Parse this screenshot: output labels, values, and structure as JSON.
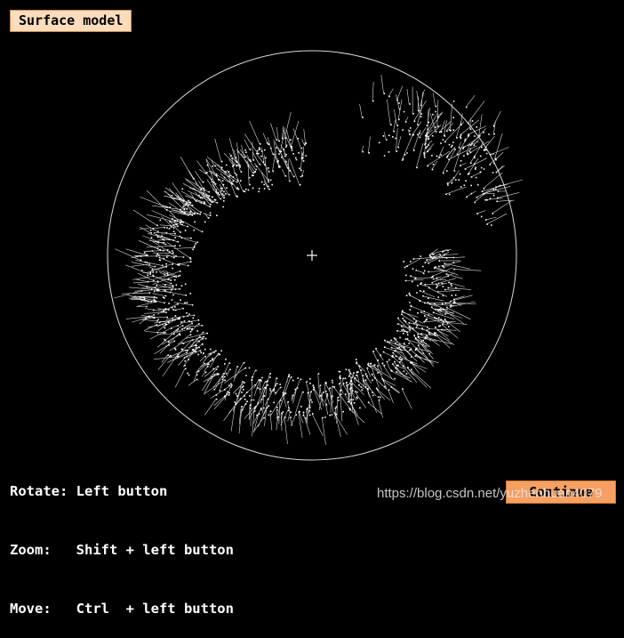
{
  "window": {
    "title_badge": "Surface model"
  },
  "viewport": {
    "trackball_icon": "trackball-circle",
    "center_icon": "crosshair-icon",
    "model_color": "#ffffff",
    "background": "#000000"
  },
  "help": {
    "rotate": "Rotate: Left button",
    "zoom": "Zoom:   Shift + left button",
    "move": "Move:   Ctrl  + left button"
  },
  "actions": {
    "continue_label": "Continue"
  },
  "watermark": "https://blog.csdn.net/yuzhenhuan4079",
  "colors": {
    "badge_bg": "#fcdcbc",
    "button_bg": "#f7a062"
  }
}
